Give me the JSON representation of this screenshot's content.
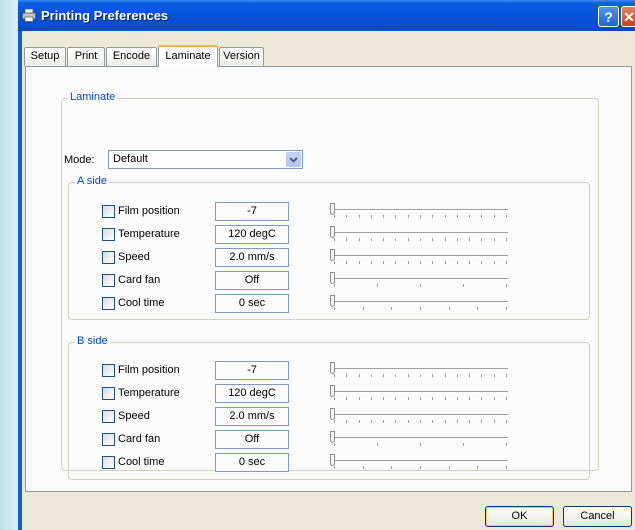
{
  "window": {
    "title": "Printing Preferences"
  },
  "titlebar_buttons": {
    "help": "?",
    "close": "✕"
  },
  "tabs": [
    {
      "label": "Setup"
    },
    {
      "label": "Print"
    },
    {
      "label": "Encode"
    },
    {
      "label": "Laminate",
      "active": true
    },
    {
      "label": "Version"
    }
  ],
  "laminate": {
    "group_label": "Laminate",
    "mode_label": "Mode:",
    "mode_value": "Default"
  },
  "a_side": {
    "label": "A side",
    "rows": [
      {
        "label": "Film position",
        "value": "-7",
        "ticks": 15
      },
      {
        "label": "Temperature",
        "value": "120 degC",
        "ticks": 15
      },
      {
        "label": "Speed",
        "value": "2.0 mm/s",
        "ticks": 15
      },
      {
        "label": "Card fan",
        "value": "Off",
        "ticks": 5
      },
      {
        "label": "Cool time",
        "value": "0 sec",
        "ticks": 7
      }
    ]
  },
  "b_side": {
    "label": "B side",
    "rows": [
      {
        "label": "Film position",
        "value": "-7",
        "ticks": 15
      },
      {
        "label": "Temperature",
        "value": "120 degC",
        "ticks": 15
      },
      {
        "label": "Speed",
        "value": "2.0 mm/s",
        "ticks": 15
      },
      {
        "label": "Card fan",
        "value": "Off",
        "ticks": 5
      },
      {
        "label": "Cool time",
        "value": "0 sec",
        "ticks": 7
      }
    ]
  },
  "buttons": {
    "ok": "OK",
    "cancel": "Cancel"
  }
}
